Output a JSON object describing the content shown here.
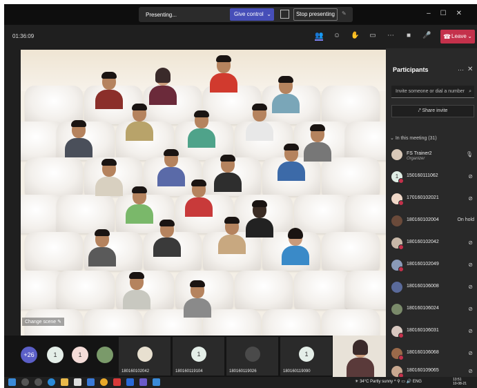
{
  "presenting_bar": {
    "status": "Presenting...",
    "give_control": "Give control",
    "stop_presenting": "Stop presenting"
  },
  "meeting": {
    "timer": "01:36:09",
    "leave_label": "Leave"
  },
  "stage": {
    "change_scene": "Change scene"
  },
  "participants": {
    "title": "Participants",
    "invite_placeholder": "Invite someone or dial a number",
    "share_invite": "Share invite",
    "in_meeting_label": "In this meeting (31)",
    "list": [
      {
        "name": "FS Trainer2",
        "role": "Organizer",
        "status": ""
      },
      {
        "name": "150160111062",
        "role": "",
        "status": ""
      },
      {
        "name": "170160102021",
        "role": "",
        "status": ""
      },
      {
        "name": "180160102004",
        "role": "",
        "status": "On hold"
      },
      {
        "name": "180160102042",
        "role": "",
        "status": ""
      },
      {
        "name": "180160102049",
        "role": "",
        "status": ""
      },
      {
        "name": "180160106008",
        "role": "",
        "status": ""
      },
      {
        "name": "180160106024",
        "role": "",
        "status": ""
      },
      {
        "name": "180160106031",
        "role": "",
        "status": ""
      },
      {
        "name": "180160106068",
        "role": "",
        "status": ""
      },
      {
        "name": "180160109065",
        "role": "",
        "status": ""
      }
    ]
  },
  "bottom_strip": {
    "overflow_count": "+26",
    "avatar_letter": "1",
    "tiles": [
      {
        "name": "180160102042"
      },
      {
        "name": "180160119104"
      },
      {
        "name": "180160119026"
      },
      {
        "name": "180160119090"
      }
    ]
  },
  "taskbar": {
    "weather": "34°C  Partly sunny",
    "language": "ENG",
    "time": "13:51",
    "date": "10-08-21"
  },
  "colors": {
    "accent": "#464eb8",
    "leave": "#c4314b",
    "panel_bg": "#292929",
    "app_bg": "#1f1f1f"
  }
}
